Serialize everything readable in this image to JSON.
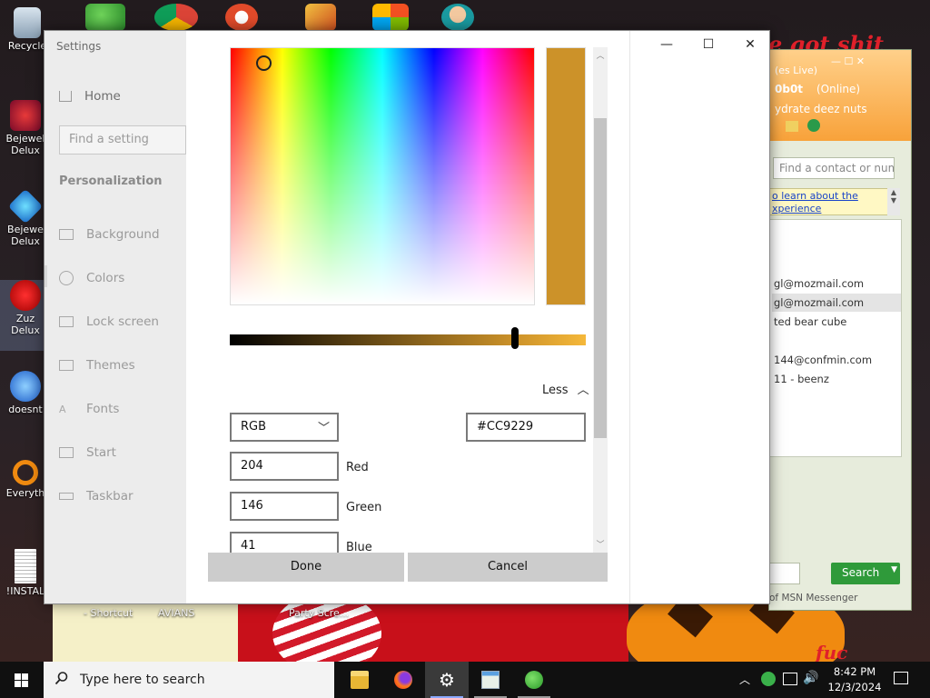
{
  "desktop": {
    "icons": [
      {
        "label": "Recycle",
        "icon": "recycle-bin-icon"
      },
      {
        "label": "Bejewel",
        "label2": "Delux",
        "icon": "bejeweled-icon"
      },
      {
        "label": "Bejewe",
        "label2": "Delux",
        "icon": "bejeweled-icon"
      },
      {
        "label": "Zuz",
        "label2": "Delux",
        "icon": "zuma-icon"
      },
      {
        "label": "doesnt",
        "icon": "messenger-icon"
      },
      {
        "label": "Everyth",
        "icon": "everything-search-icon"
      },
      {
        "label": "!INSTAL",
        "icon": "document-icon"
      }
    ],
    "bottom_labels": [
      "- Shortcut",
      "AVIANS",
      "Party Scre..."
    ],
    "wallpaper_text": "e got shit",
    "wallpaper_text2": "fuc"
  },
  "msn": {
    "header_line1": "(es Live)",
    "header_user": "0b0t",
    "header_status": "(Online)",
    "header_message": "ydrate deez nuts",
    "search_placeholder": "Find a contact or numbe",
    "promo_link1": "o learn about the",
    "promo_link2": "xperience",
    "contacts": [
      {
        "text": "gl@mozmail.com",
        "selected": false
      },
      {
        "text": "gl@mozmail.com",
        "selected": true
      },
      {
        "text": "ted bear cube",
        "selected": false
      },
      {
        "text": "144@confmin.com",
        "selected": false
      },
      {
        "text": "11 - beenz",
        "selected": false
      }
    ],
    "search_button": "Search",
    "footer": "of MSN Messenger",
    "colors": {
      "header": "#f8a23a",
      "button": "#2f9a3a"
    }
  },
  "settings": {
    "window_title": "Settings",
    "home": "Home",
    "search_placeholder": "Find a setting",
    "section": "Personalization",
    "nav": [
      {
        "label": "Background",
        "icon": "background-icon"
      },
      {
        "label": "Colors",
        "icon": "colors-icon"
      },
      {
        "label": "Lock screen",
        "icon": "lock-screen-icon"
      },
      {
        "label": "Themes",
        "icon": "themes-icon"
      },
      {
        "label": "Fonts",
        "icon": "fonts-icon"
      },
      {
        "label": "Start",
        "icon": "start-icon"
      },
      {
        "label": "Taskbar",
        "icon": "taskbar-icon"
      }
    ],
    "titlebar": {
      "minimize": "—",
      "maximize": "☐",
      "close": "✕"
    }
  },
  "color_picker": {
    "selected_color": "#CC9229",
    "brightness_fraction": 0.8,
    "toggle_label": "Less",
    "mode": "RGB",
    "hex_value": "#CC9229",
    "channels": [
      {
        "value": "204",
        "label": "Red"
      },
      {
        "value": "146",
        "label": "Green"
      },
      {
        "value": "41",
        "label": "Blue"
      }
    ],
    "done_label": "Done",
    "cancel_label": "Cancel"
  },
  "taskbar": {
    "search_placeholder": "Type here to search",
    "apps": [
      {
        "name": "file-explorer",
        "active": false
      },
      {
        "name": "firefox",
        "active": false
      },
      {
        "name": "settings",
        "active": true
      },
      {
        "name": "task-manager",
        "active": false
      },
      {
        "name": "msn-messenger",
        "active": false
      }
    ],
    "time": "8:42 PM",
    "date": "12/3/2024"
  }
}
